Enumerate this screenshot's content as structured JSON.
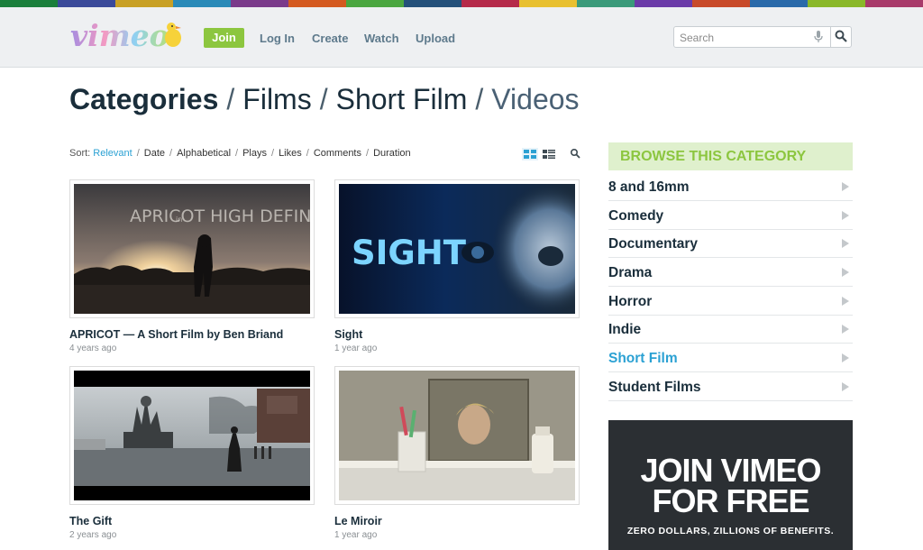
{
  "brand": {
    "logo_text": "vimeo",
    "stripe_colors": [
      "#1a7f3c",
      "#3a4a9a",
      "#c8a025",
      "#2a8ab8",
      "#7a3a8a",
      "#d45a20",
      "#4aa640",
      "#24507a",
      "#b52a4a",
      "#e8c030",
      "#3a9a7a",
      "#6a3aa8",
      "#c84a2a",
      "#2a6aaa",
      "#8ab82a",
      "#a83a6a"
    ]
  },
  "header": {
    "join_label": "Join",
    "nav": [
      {
        "label": "Log In"
      },
      {
        "label": "Create"
      },
      {
        "label": "Watch"
      },
      {
        "label": "Upload"
      }
    ],
    "search_placeholder": "Search",
    "mic_icon": "microphone-icon",
    "search_icon": "search-icon"
  },
  "page_title": {
    "parts": [
      "Categories",
      "Films",
      "Short Film",
      "Videos"
    ],
    "separator": "/"
  },
  "sort": {
    "label": "Sort:",
    "options": [
      "Relevant",
      "Date",
      "Alphabetical",
      "Plays",
      "Likes",
      "Comments",
      "Duration"
    ],
    "active": "Relevant"
  },
  "videos": [
    {
      "title": "APRICOT — A Short Film by Ben Briand",
      "age": "4 years ago",
      "thumb_text": "APRICOT HIGH DEFINITION",
      "thumb_text_small": "in"
    },
    {
      "title": "Sight",
      "age": "1 year ago",
      "thumb_text": "SIGHT"
    },
    {
      "title": "The Gift",
      "age": "2 years ago"
    },
    {
      "title": "Le Miroir",
      "age": "1 year ago"
    }
  ],
  "browse": {
    "heading": "BROWSE THIS CATEGORY",
    "categories": [
      {
        "label": "8 and 16mm"
      },
      {
        "label": "Comedy"
      },
      {
        "label": "Documentary"
      },
      {
        "label": "Drama"
      },
      {
        "label": "Horror"
      },
      {
        "label": "Indie"
      },
      {
        "label": "Short Film",
        "active": true
      },
      {
        "label": "Student Films"
      }
    ]
  },
  "promo": {
    "line1": "JOIN VIMEO",
    "line2": "FOR FREE",
    "sub": "ZERO DOLLARS, ZILLIONS OF BENEFITS."
  },
  "colors": {
    "accent_green": "#8cc63f",
    "accent_blue": "#2ba1d3",
    "text_dark": "#1a2e3b"
  }
}
